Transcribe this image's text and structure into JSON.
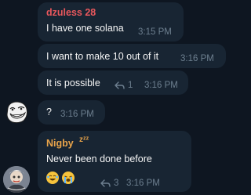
{
  "messages": [
    {
      "sender": "dzuless 28",
      "sender_color": "#e8575c",
      "text": "I have one solana",
      "time": "3:15 PM"
    },
    {
      "text": "I want to make 10 out of it",
      "time": "3:16 PM"
    },
    {
      "text": "It is possible",
      "reply_count": "1",
      "time": "3:16 PM"
    },
    {
      "text": "?",
      "time": "3:16 PM"
    },
    {
      "sender": "Nigby",
      "sender_status": "zᶻᶻ",
      "sender_color": "#e9a44a",
      "text": "Never been done before",
      "reply_count": "3",
      "time": "3:16 PM"
    }
  ],
  "avatars": [
    {
      "icon": "troll-face-avatar-icon"
    },
    {
      "icon": "user-photo-avatar-icon"
    }
  ],
  "reactions": [
    {
      "icon": "rofl-emoji-icon"
    },
    {
      "icon": "crying-emoji-icon"
    }
  ]
}
